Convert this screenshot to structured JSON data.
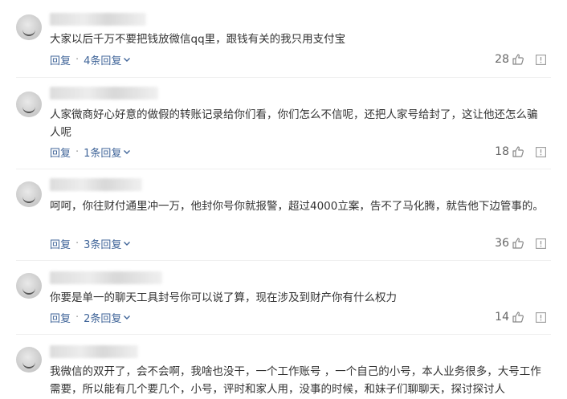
{
  "comments": [
    {
      "text": "大家以后千万不要把钱放微信qq里，跟钱有关的我只用支付宝",
      "reply_label": "回复",
      "replies_label": "4条回复",
      "likes": "28"
    },
    {
      "text": "人家微商好心好意的做假的转账记录给你们看，你们怎么不信呢，还把人家号给封了，这让他还怎么骗人呢",
      "reply_label": "回复",
      "replies_label": "1条回复",
      "likes": "18"
    },
    {
      "text": "呵呵，你往财付通里冲一万，他封你号你就报警，超过4000立案，告不了马化腾，就告他下边管事的。",
      "reply_label": "回复",
      "replies_label": "3条回复",
      "likes": "36"
    },
    {
      "text": "你要是单一的聊天工具封号你可以说了算，现在涉及到财产你有什么权力",
      "reply_label": "回复",
      "replies_label": "2条回复",
      "likes": "14"
    },
    {
      "text": "我微信的双开了，会不会啊，我啥也没干，一个工作账号 ，一个自己的小号，本人业务很多，大号工作需要，所以能有几个要几个，小号，评时和家人用，没事的时候，和妹子们聊聊天，探讨探讨人"
    }
  ],
  "icons": {
    "like": "thumbs-up-icon",
    "report": "report-icon",
    "expand": "chevron-down-icon"
  },
  "colors": {
    "link": "#406599",
    "text": "#333333",
    "muted": "#666666"
  }
}
